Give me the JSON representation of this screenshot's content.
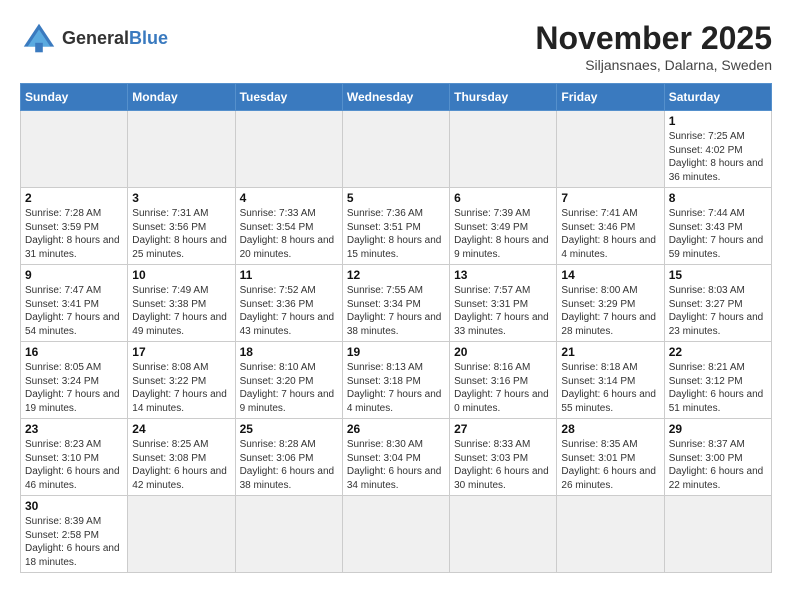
{
  "header": {
    "logo_general": "General",
    "logo_blue": "Blue",
    "month_year": "November 2025",
    "location": "Siljansnaes, Dalarna, Sweden"
  },
  "weekdays": [
    "Sunday",
    "Monday",
    "Tuesday",
    "Wednesday",
    "Thursday",
    "Friday",
    "Saturday"
  ],
  "days": [
    {
      "num": "",
      "info": "",
      "empty": true
    },
    {
      "num": "",
      "info": "",
      "empty": true
    },
    {
      "num": "",
      "info": "",
      "empty": true
    },
    {
      "num": "",
      "info": "",
      "empty": true
    },
    {
      "num": "",
      "info": "",
      "empty": true
    },
    {
      "num": "",
      "info": "",
      "empty": true
    },
    {
      "num": "1",
      "info": "Sunrise: 7:25 AM\nSunset: 4:02 PM\nDaylight: 8 hours\nand 36 minutes.",
      "empty": false
    },
    {
      "num": "2",
      "info": "Sunrise: 7:28 AM\nSunset: 3:59 PM\nDaylight: 8 hours\nand 31 minutes.",
      "empty": false
    },
    {
      "num": "3",
      "info": "Sunrise: 7:31 AM\nSunset: 3:56 PM\nDaylight: 8 hours\nand 25 minutes.",
      "empty": false
    },
    {
      "num": "4",
      "info": "Sunrise: 7:33 AM\nSunset: 3:54 PM\nDaylight: 8 hours\nand 20 minutes.",
      "empty": false
    },
    {
      "num": "5",
      "info": "Sunrise: 7:36 AM\nSunset: 3:51 PM\nDaylight: 8 hours\nand 15 minutes.",
      "empty": false
    },
    {
      "num": "6",
      "info": "Sunrise: 7:39 AM\nSunset: 3:49 PM\nDaylight: 8 hours\nand 9 minutes.",
      "empty": false
    },
    {
      "num": "7",
      "info": "Sunrise: 7:41 AM\nSunset: 3:46 PM\nDaylight: 8 hours\nand 4 minutes.",
      "empty": false
    },
    {
      "num": "8",
      "info": "Sunrise: 7:44 AM\nSunset: 3:43 PM\nDaylight: 7 hours\nand 59 minutes.",
      "empty": false
    },
    {
      "num": "9",
      "info": "Sunrise: 7:47 AM\nSunset: 3:41 PM\nDaylight: 7 hours\nand 54 minutes.",
      "empty": false
    },
    {
      "num": "10",
      "info": "Sunrise: 7:49 AM\nSunset: 3:38 PM\nDaylight: 7 hours\nand 49 minutes.",
      "empty": false
    },
    {
      "num": "11",
      "info": "Sunrise: 7:52 AM\nSunset: 3:36 PM\nDaylight: 7 hours\nand 43 minutes.",
      "empty": false
    },
    {
      "num": "12",
      "info": "Sunrise: 7:55 AM\nSunset: 3:34 PM\nDaylight: 7 hours\nand 38 minutes.",
      "empty": false
    },
    {
      "num": "13",
      "info": "Sunrise: 7:57 AM\nSunset: 3:31 PM\nDaylight: 7 hours\nand 33 minutes.",
      "empty": false
    },
    {
      "num": "14",
      "info": "Sunrise: 8:00 AM\nSunset: 3:29 PM\nDaylight: 7 hours\nand 28 minutes.",
      "empty": false
    },
    {
      "num": "15",
      "info": "Sunrise: 8:03 AM\nSunset: 3:27 PM\nDaylight: 7 hours\nand 23 minutes.",
      "empty": false
    },
    {
      "num": "16",
      "info": "Sunrise: 8:05 AM\nSunset: 3:24 PM\nDaylight: 7 hours\nand 19 minutes.",
      "empty": false
    },
    {
      "num": "17",
      "info": "Sunrise: 8:08 AM\nSunset: 3:22 PM\nDaylight: 7 hours\nand 14 minutes.",
      "empty": false
    },
    {
      "num": "18",
      "info": "Sunrise: 8:10 AM\nSunset: 3:20 PM\nDaylight: 7 hours\nand 9 minutes.",
      "empty": false
    },
    {
      "num": "19",
      "info": "Sunrise: 8:13 AM\nSunset: 3:18 PM\nDaylight: 7 hours\nand 4 minutes.",
      "empty": false
    },
    {
      "num": "20",
      "info": "Sunrise: 8:16 AM\nSunset: 3:16 PM\nDaylight: 7 hours\nand 0 minutes.",
      "empty": false
    },
    {
      "num": "21",
      "info": "Sunrise: 8:18 AM\nSunset: 3:14 PM\nDaylight: 6 hours\nand 55 minutes.",
      "empty": false
    },
    {
      "num": "22",
      "info": "Sunrise: 8:21 AM\nSunset: 3:12 PM\nDaylight: 6 hours\nand 51 minutes.",
      "empty": false
    },
    {
      "num": "23",
      "info": "Sunrise: 8:23 AM\nSunset: 3:10 PM\nDaylight: 6 hours\nand 46 minutes.",
      "empty": false
    },
    {
      "num": "24",
      "info": "Sunrise: 8:25 AM\nSunset: 3:08 PM\nDaylight: 6 hours\nand 42 minutes.",
      "empty": false
    },
    {
      "num": "25",
      "info": "Sunrise: 8:28 AM\nSunset: 3:06 PM\nDaylight: 6 hours\nand 38 minutes.",
      "empty": false
    },
    {
      "num": "26",
      "info": "Sunrise: 8:30 AM\nSunset: 3:04 PM\nDaylight: 6 hours\nand 34 minutes.",
      "empty": false
    },
    {
      "num": "27",
      "info": "Sunrise: 8:33 AM\nSunset: 3:03 PM\nDaylight: 6 hours\nand 30 minutes.",
      "empty": false
    },
    {
      "num": "28",
      "info": "Sunrise: 8:35 AM\nSunset: 3:01 PM\nDaylight: 6 hours\nand 26 minutes.",
      "empty": false
    },
    {
      "num": "29",
      "info": "Sunrise: 8:37 AM\nSunset: 3:00 PM\nDaylight: 6 hours\nand 22 minutes.",
      "empty": false
    },
    {
      "num": "30",
      "info": "Sunrise: 8:39 AM\nSunset: 2:58 PM\nDaylight: 6 hours\nand 18 minutes.",
      "empty": false
    },
    {
      "num": "",
      "info": "",
      "empty": true
    },
    {
      "num": "",
      "info": "",
      "empty": true
    },
    {
      "num": "",
      "info": "",
      "empty": true
    },
    {
      "num": "",
      "info": "",
      "empty": true
    },
    {
      "num": "",
      "info": "",
      "empty": true
    },
    {
      "num": "",
      "info": "",
      "empty": true
    }
  ]
}
